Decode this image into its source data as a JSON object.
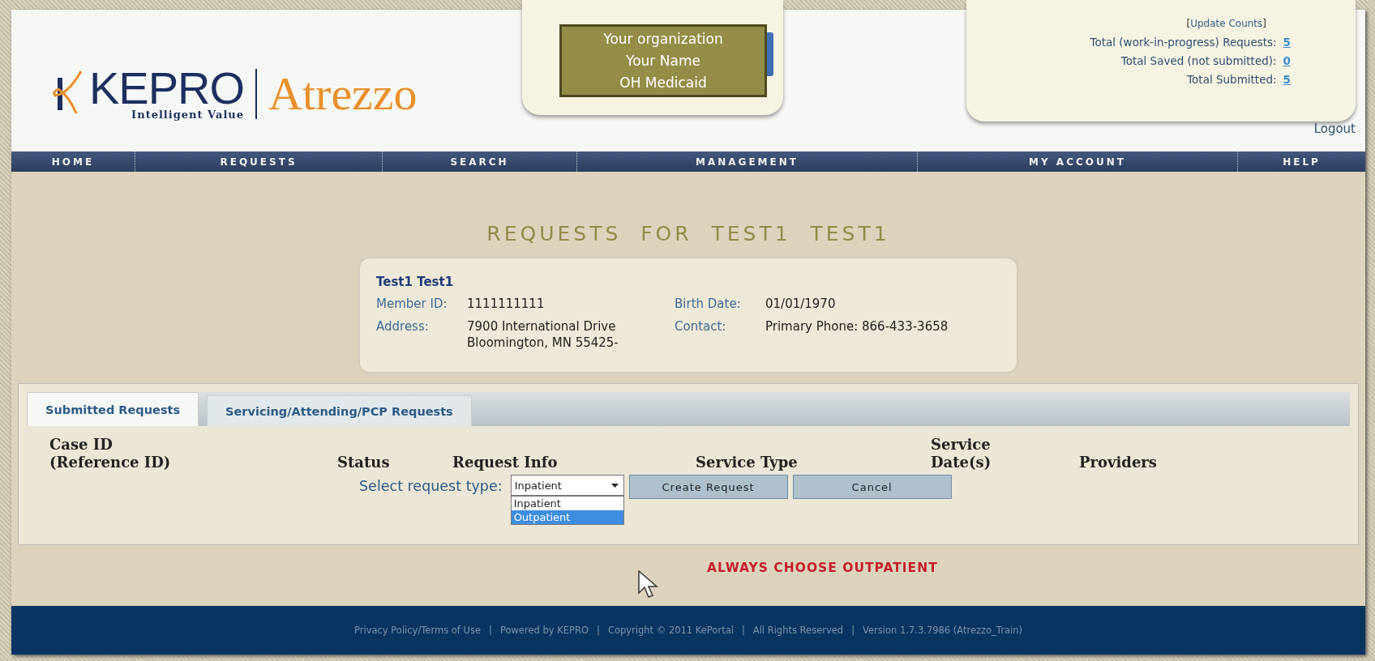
{
  "logo": {
    "brand": "KEPRO",
    "tagline": "Intelligent Value",
    "product": "Atrezzo"
  },
  "user_box": {
    "lines": [
      "Your organization",
      "Your Name",
      "OH Medicaid"
    ]
  },
  "counts": {
    "update_link": "Update Counts",
    "open_bracket": "[",
    "close_bracket": "]",
    "rows": [
      {
        "label": "Total (work-in-progress) Requests:",
        "value": "5"
      },
      {
        "label": "Total Saved (not submitted):",
        "value": "0"
      },
      {
        "label": "Total Submitted:",
        "value": "5"
      }
    ]
  },
  "logout": "Logout",
  "nav": [
    "HOME",
    "REQUESTS",
    "SEARCH",
    "MANAGEMENT",
    "MY ACCOUNT",
    "HELP"
  ],
  "page_title": "REQUESTS  FOR  TEST1  TEST1",
  "member": {
    "name": "Test1 Test1",
    "fields": [
      {
        "label": "Member ID:",
        "value": "1111111111"
      },
      {
        "label": "Birth Date:",
        "value": "01/01/1970"
      },
      {
        "label": "Address:",
        "value": "7900 International Drive",
        "value2": "Bloomington, MN 55425-"
      },
      {
        "label": "Contact:",
        "value": "Primary Phone: 866-433-3658"
      }
    ]
  },
  "tabs": [
    {
      "label": "Submitted Requests",
      "selected": true
    },
    {
      "label": "Servicing/Attending/PCP Requests",
      "selected": false
    }
  ],
  "columns": [
    {
      "lines": [
        "Case ID",
        "(Reference ID)"
      ]
    },
    {
      "lines": [
        "Status"
      ]
    },
    {
      "lines": [
        "Request Info"
      ]
    },
    {
      "lines": [
        "Service Type"
      ]
    },
    {
      "lines": [
        "Service",
        "Date(s)"
      ]
    },
    {
      "lines": [
        "Providers"
      ]
    }
  ],
  "request_type": {
    "label": "Select request type:",
    "value": "Inpatient",
    "expanded": true,
    "options": [
      {
        "label": "Inpatient",
        "highlighted": false
      },
      {
        "label": "Outpatient",
        "highlighted": true
      }
    ]
  },
  "buttons": [
    "Create Request",
    "Cancel"
  ],
  "note": "ALWAYS CHOOSE OUTPATIENT",
  "footer": {
    "separator": "|",
    "items": [
      "Privacy Policy/Terms of Use",
      "Powered by KEPRO",
      "Copyright © 2011 KePortal",
      "All Rights Reserved",
      "Version 1.7.3.7986 (Atrezzo_Train)"
    ]
  }
}
